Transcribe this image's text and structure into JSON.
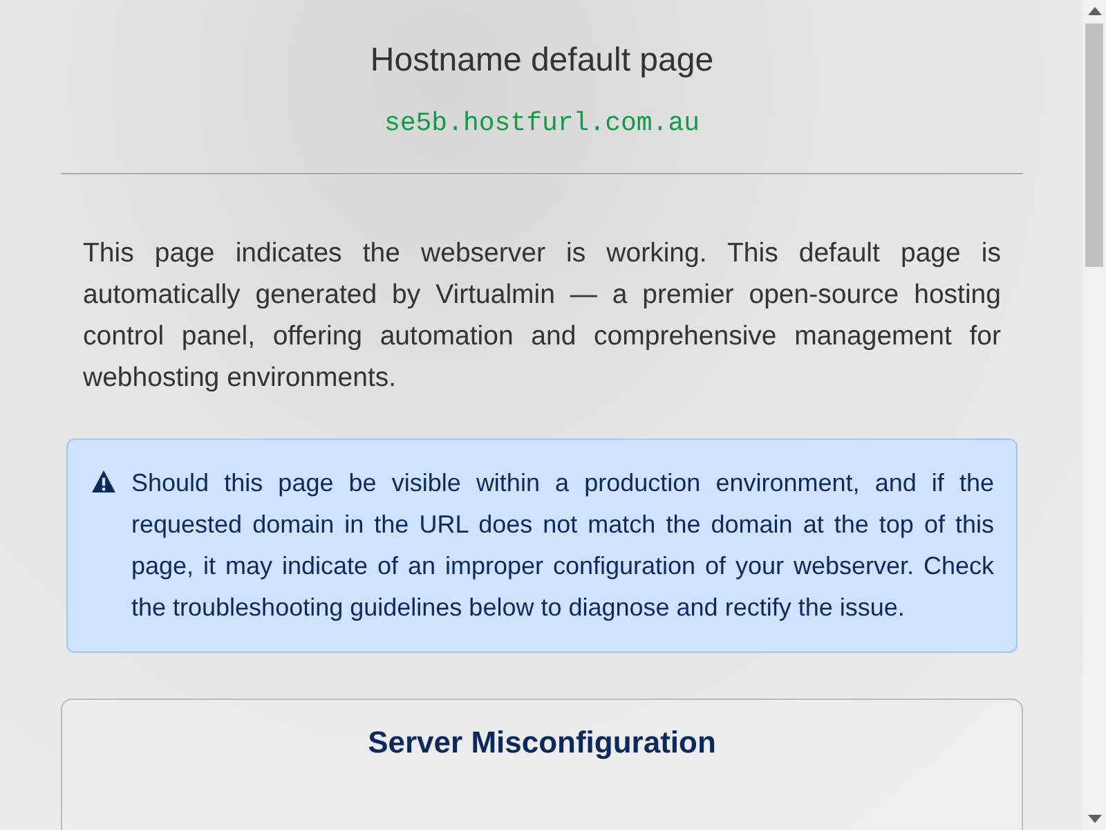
{
  "page": {
    "title": "Hostname default page",
    "hostname": "se5b.hostfurl.com.au"
  },
  "intro": "This page indicates the webserver is working. This default page is automatically generated by Virtualmin — a premier open-source hosting control panel, offering automation and comprehensive management for webhosting environments.",
  "alert": {
    "kind": "warning",
    "text": "Should this page be visible within a production environment, and if the requested domain in the URL does not match the domain at the top of this page, it may indicate of an improper configuration of your webserver. Check the troubleshooting guidelines below to diagnose and rectify the issue."
  },
  "cards": [
    {
      "title": "Server Misconfiguration"
    }
  ]
}
